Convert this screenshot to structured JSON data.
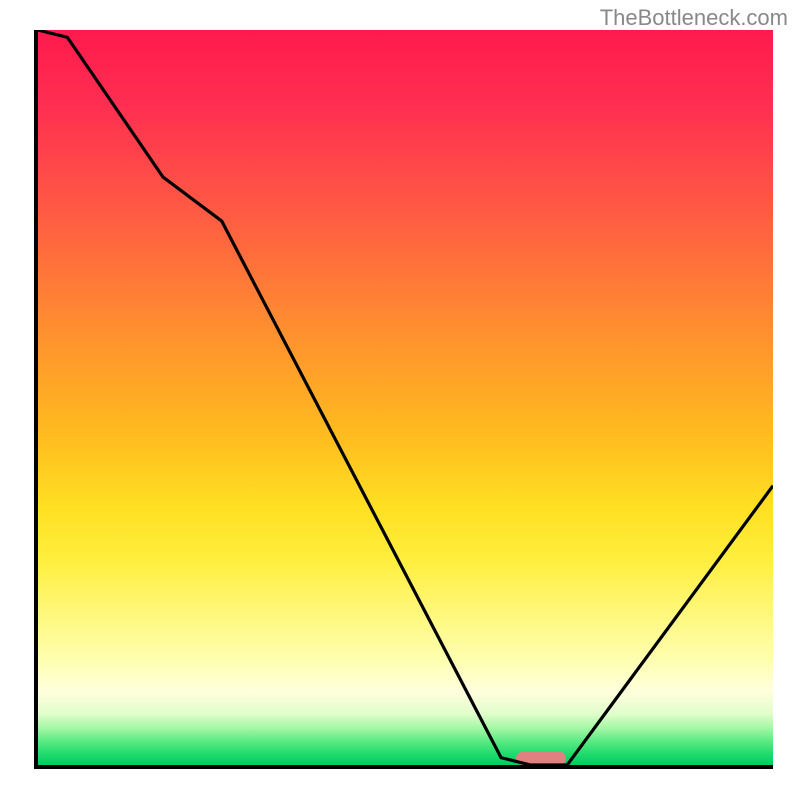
{
  "watermark": "TheBottleneck.com",
  "colors": {
    "gradient_top": "#ff1a4d",
    "gradient_mid": "#ffde20",
    "gradient_bottom": "#00cc5e",
    "curve": "#000000",
    "marker": "#e08080",
    "axis": "#000000"
  },
  "chart_data": {
    "type": "line",
    "title": "",
    "xlabel": "",
    "ylabel": "",
    "xlim": [
      0,
      100
    ],
    "ylim": [
      0,
      100
    ],
    "x": [
      0,
      4,
      17,
      25,
      63,
      67,
      72,
      100
    ],
    "values": [
      105,
      99,
      80,
      74,
      1,
      0,
      0,
      38
    ],
    "marker_x_range": [
      66,
      73
    ],
    "annotations": []
  }
}
